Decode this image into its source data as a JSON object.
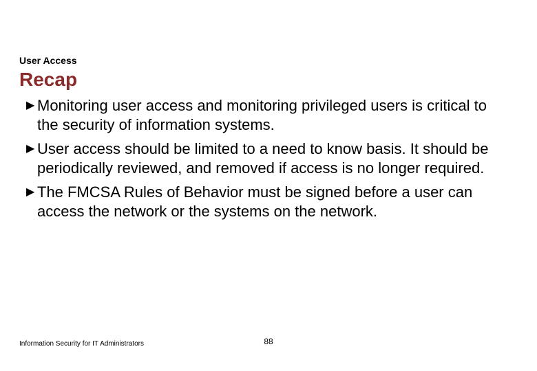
{
  "section_label": "User Access",
  "title": "Recap",
  "bullets": [
    "Monitoring user access and monitoring privileged users is critical to the security of information systems.",
    "User access should be limited to a need to know basis. It should be periodically reviewed, and removed if access is no longer required.",
    "The FMCSA Rules of Behavior must be signed before a user can access the network or the systems on the network."
  ],
  "footer": "Information Security for IT Administrators",
  "page_number": "88"
}
